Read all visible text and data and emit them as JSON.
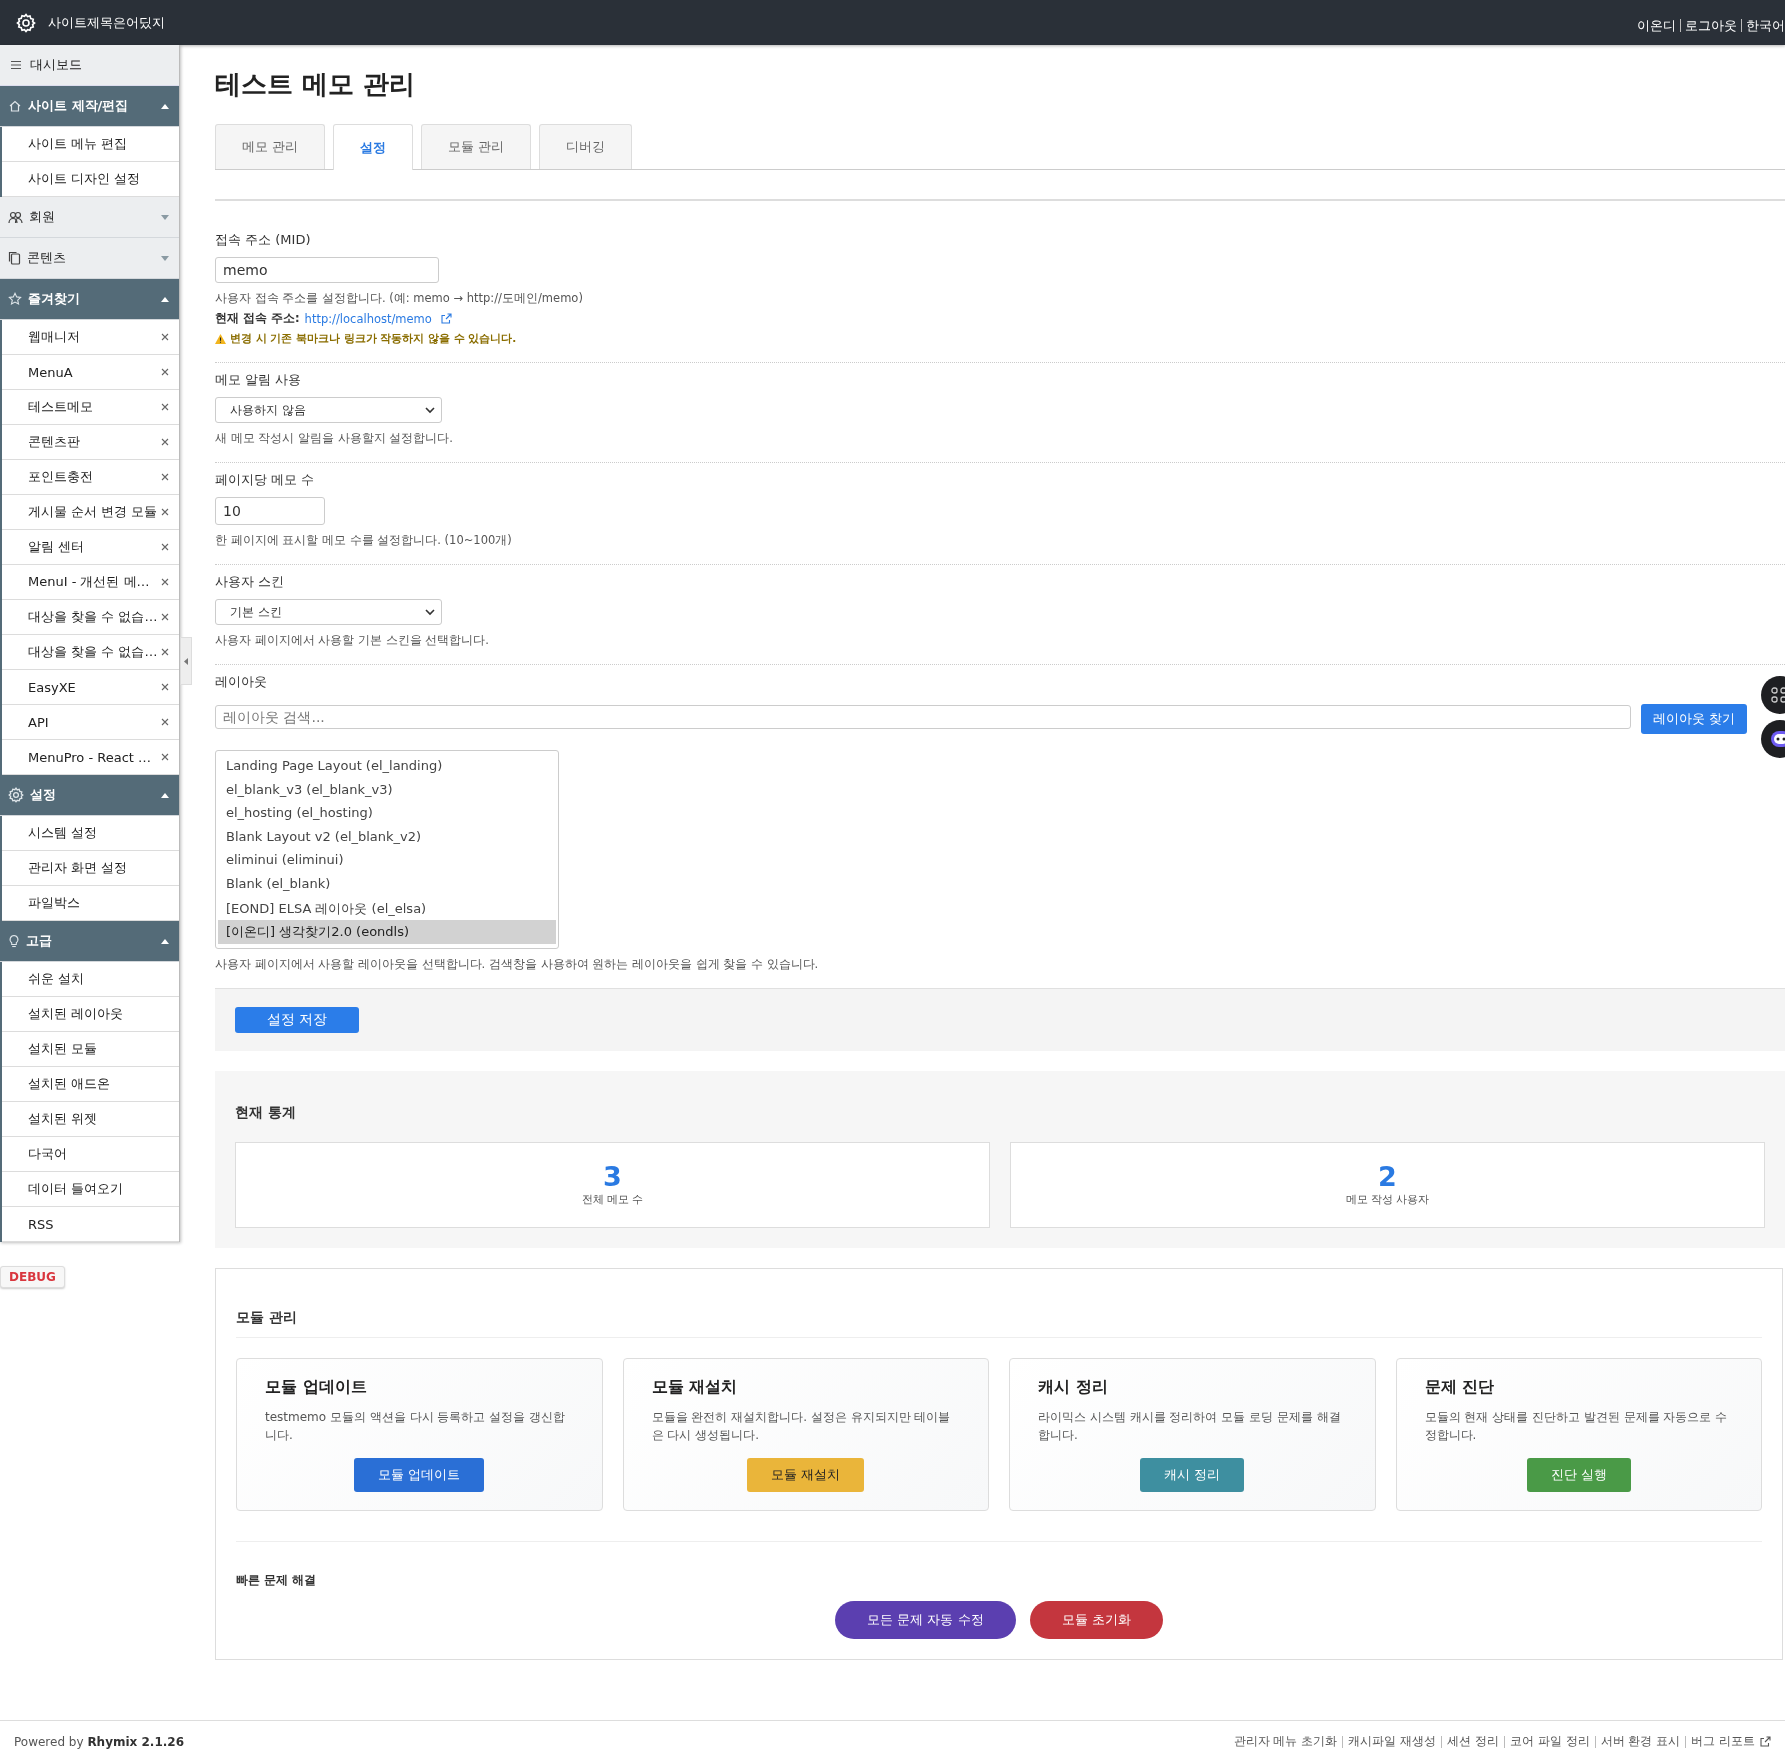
{
  "topbar": {
    "site_title": "사이트제목은어딨지",
    "user_links": [
      "이온디",
      "로그아웃",
      "한국어"
    ]
  },
  "sidebar": {
    "items": [
      {
        "kind": "link",
        "label": "대시보드"
      },
      {
        "kind": "group",
        "label": "사이트 제작/편집",
        "expanded": true,
        "children": [
          {
            "label": "사이트 메뉴 편집",
            "removable": false
          },
          {
            "label": "사이트 디자인 설정",
            "removable": false
          }
        ]
      },
      {
        "kind": "group",
        "label": "회원",
        "expanded": false
      },
      {
        "kind": "group",
        "label": "콘텐츠",
        "expanded": false
      },
      {
        "kind": "group",
        "label": "즐겨찾기",
        "expanded": true,
        "children": [
          {
            "label": "웹매니저",
            "removable": true
          },
          {
            "label": "MenuA",
            "removable": true
          },
          {
            "label": "테스트메모",
            "removable": true
          },
          {
            "label": "콘텐츠판",
            "removable": true
          },
          {
            "label": "포인트충전",
            "removable": true
          },
          {
            "label": "게시물 순서 변경 모듈",
            "removable": true
          },
          {
            "label": "알림 센터",
            "removable": true
          },
          {
            "label": "MenuI - 개선된 메…",
            "removable": true
          },
          {
            "label": "대상을 찾을 수 없습…",
            "removable": true
          },
          {
            "label": "대상을 찾을 수 없습…",
            "removable": true
          },
          {
            "label": "EasyXE",
            "removable": true
          },
          {
            "label": "API",
            "removable": true
          },
          {
            "label": "MenuPro - React …",
            "removable": true
          }
        ]
      },
      {
        "kind": "group",
        "label": "설정",
        "expanded": true,
        "children": [
          {
            "label": "시스템 설정",
            "removable": false
          },
          {
            "label": "관리자 화면 설정",
            "removable": false
          },
          {
            "label": "파일박스",
            "removable": false
          }
        ]
      },
      {
        "kind": "group",
        "label": "고급",
        "expanded": true,
        "children": [
          {
            "label": "쉬운 설치",
            "removable": false
          },
          {
            "label": "설치된 레이아웃",
            "removable": false
          },
          {
            "label": "설치된 모듈",
            "removable": false
          },
          {
            "label": "설치된 애드온",
            "removable": false
          },
          {
            "label": "설치된 위젯",
            "removable": false
          },
          {
            "label": "다국어",
            "removable": false
          },
          {
            "label": "데이터 들여오기",
            "removable": false
          },
          {
            "label": "RSS",
            "removable": false
          }
        ]
      }
    ],
    "debug_badge": "DEBUG"
  },
  "main": {
    "page_title": "테스트 메모 관리",
    "tabs": [
      {
        "label": "메모 관리",
        "selected": false
      },
      {
        "label": "설정",
        "selected": true
      },
      {
        "label": "모듈 관리",
        "selected": false
      },
      {
        "label": "디버깅",
        "selected": false
      }
    ],
    "fields": [
      {
        "kind": "text",
        "label": "접속 주소 (MID)",
        "value": "memo",
        "help": "사용자 접속 주소를 설정합니다. (예: memo → http://도메인/memo)",
        "current_label": "현재 접속 주소:",
        "current_link": "http://localhost/memo",
        "warning": "변경 시 기존 북마크나 링크가 작동하지 않을 수 있습니다."
      },
      {
        "kind": "select",
        "label": "메모 알림 사용",
        "value": "사용하지 않음",
        "help": "새 메모 작성시 알림을 사용할지 설정합니다."
      },
      {
        "kind": "number",
        "label": "페이지당 메모 수",
        "value": "10",
        "help": "한 페이지에 표시할 메모 수를 설정합니다. (10~100개)"
      },
      {
        "kind": "select",
        "label": "사용자 스킨",
        "value": "기본 스킨",
        "help": "사용자 페이지에서 사용할 기본 스킨을 선택합니다."
      },
      {
        "kind": "layout",
        "label": "레이아웃",
        "placeholder": "레이아웃 검색...",
        "button": "레이아웃 찾기",
        "options": [
          {
            "label": "Landing Page Layout (el_landing)",
            "selected": false
          },
          {
            "label": "el_blank_v3 (el_blank_v3)",
            "selected": false
          },
          {
            "label": "el_hosting (el_hosting)",
            "selected": false
          },
          {
            "label": "Blank Layout v2 (el_blank_v2)",
            "selected": false
          },
          {
            "label": "eliminui (eliminui)",
            "selected": false
          },
          {
            "label": "Blank (el_blank)",
            "selected": false
          },
          {
            "label": "[EOND] ELSA 레이아웃 (el_elsa)",
            "selected": false
          },
          {
            "label": "[이온디] 생각찾기2.0 (eondls)",
            "selected": true
          }
        ],
        "help": "사용자 페이지에서 사용할 레이아웃을 선택합니다. 검색창을 사용하여 원하는 레이아웃을 쉽게 찾을 수 있습니다."
      }
    ],
    "save_button": "설정 저장",
    "stats": {
      "title": "현재 통계",
      "items": [
        {
          "value": "3",
          "label": "전체 메모 수"
        },
        {
          "value": "2",
          "label": "메모 작성 사용자"
        }
      ]
    },
    "module_panel": {
      "title": "모듈 관리",
      "cards": [
        {
          "title": "모듈 업데이트",
          "description": "testmemo 모듈의 액션을 다시 등록하고 설정을 갱신합니다.",
          "button": "모듈 업데이트",
          "color": "#2a6fd6"
        },
        {
          "title": "모듈 재설치",
          "description": "모듈을 완전히 재설치합니다. 설정은 유지되지만 테이블은 다시 생성됩니다.",
          "button": "모듈 재설치",
          "color": "#eab53a"
        },
        {
          "title": "캐시 정리",
          "description": "라이믹스 시스템 캐시를 정리하여 모듈 로딩 문제를 해결합니다.",
          "button": "캐시 정리",
          "color": "#3e8fa0"
        },
        {
          "title": "문제 진단",
          "description": "모듈의 현재 상태를 진단하고 발견된 문제를 자동으로 수정합니다.",
          "button": "진단 실행",
          "color": "#4a9a47"
        }
      ],
      "quick_fix": {
        "title": "빠른 문제 해결",
        "buttons": [
          {
            "label": "모든 문제 자동 수정",
            "color": "#5b3fb0"
          },
          {
            "label": "모듈 초기화",
            "color": "#c4363e"
          }
        ]
      }
    }
  },
  "footer": {
    "powered": "Powered by **Rhymix 2.1.26**",
    "links": [
      "관리자 메뉴 초기화",
      "캐시파일 재생성",
      "세션 정리",
      "코어 파일 정리",
      "서버 환경 표시",
      "버그 리포트"
    ]
  }
}
